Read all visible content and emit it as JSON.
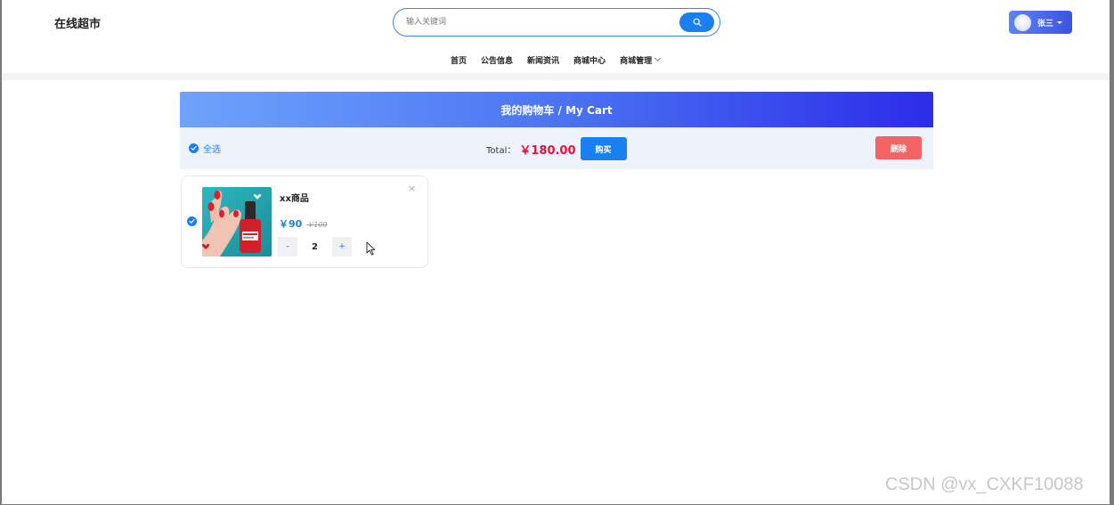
{
  "header": {
    "logo": "在线超市",
    "search": {
      "placeholder": "输入关键词",
      "value": ""
    },
    "user": {
      "name": "张三"
    },
    "nav": [
      "首页",
      "公告信息",
      "新闻资讯",
      "商城中心",
      "商城管理"
    ]
  },
  "cart": {
    "title": "我的购物车 / My Cart",
    "select_all_label": "全选",
    "total_label": "Total：",
    "total_value": "￥180.00",
    "buy_label": "购买",
    "delete_label": "删除",
    "items": [
      {
        "name": "xx商品",
        "price": "￥90",
        "old_price": "￥100",
        "quantity": "2",
        "minus_label": "-",
        "plus_label": "+",
        "close_label": "×",
        "checked": true
      }
    ]
  },
  "colors": {
    "accent": "#1a7ff0",
    "total_price": "#e0143c",
    "delete": "#f56464",
    "title_gradient_start": "#6ea3fb",
    "title_gradient_end": "#2c2ce9"
  },
  "icons": {
    "search_button": "search-icon",
    "user_avatar": "avatar",
    "select_all": "check-circle-icon",
    "item_check": "check-circle-icon",
    "card_close": "close-icon",
    "nav_dropdown": "chevron-down-icon"
  },
  "watermark": "CSDN @vx_CXKF10088"
}
